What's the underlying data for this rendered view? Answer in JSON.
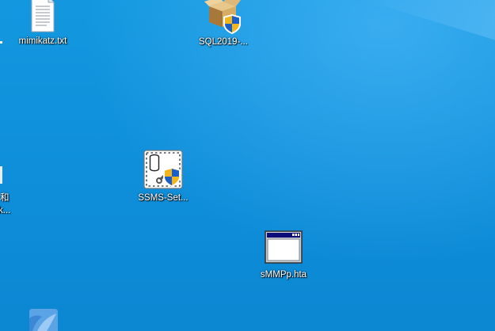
{
  "desktop": {
    "icons": [
      {
        "label": "mimikatz.txt",
        "icon": "text-file-icon"
      },
      {
        "label": "SQL2019-...",
        "icon": "installer-package-icon"
      },
      {
        "label": "SSMS-Set...",
        "icon": "ssms-setup-icon"
      },
      {
        "label": "sMMPp.hta",
        "icon": "hta-window-icon"
      },
      {
        "label": "",
        "icon": "partial-blue-app-icon"
      }
    ],
    "partial_left": {
      "line1": "和",
      "line2": "k..."
    }
  },
  "colors": {
    "wallpaper": "#0e8ad6",
    "label_text": "#ffffff",
    "shield_blue": "#1a5fc9",
    "shield_yellow": "#f2b51e"
  }
}
